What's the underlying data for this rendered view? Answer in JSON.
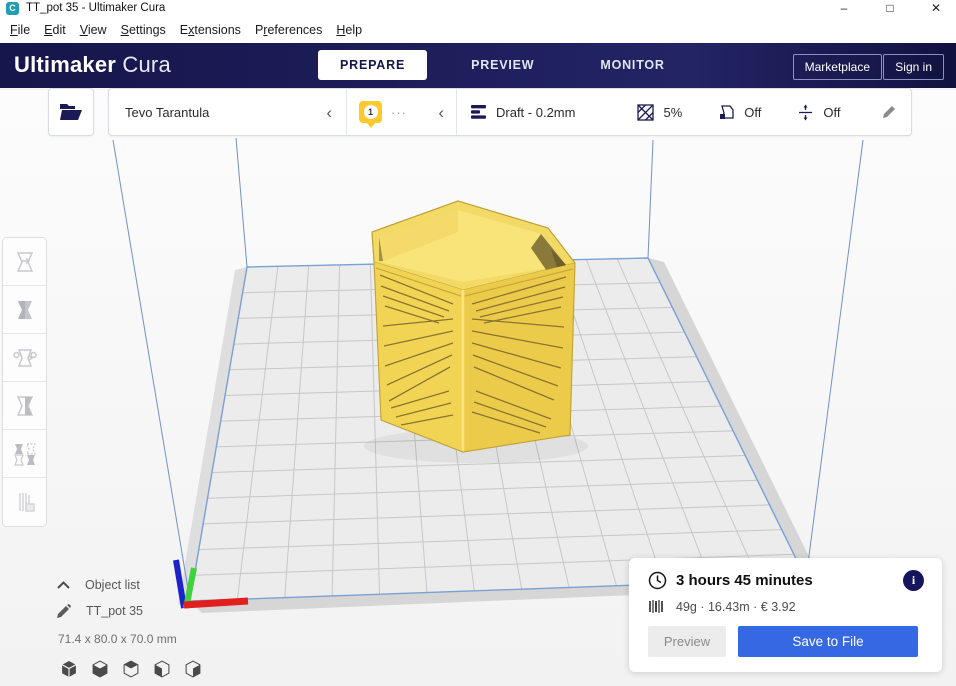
{
  "window": {
    "title": "TT_pot 35 - Ultimaker Cura",
    "controls": {
      "minimize": "–",
      "maximize": "□",
      "close": "✕"
    }
  },
  "menu": {
    "items": [
      {
        "name": "file",
        "pre": "",
        "key": "F",
        "post": "ile"
      },
      {
        "name": "edit",
        "pre": "",
        "key": "E",
        "post": "dit"
      },
      {
        "name": "view",
        "pre": "",
        "key": "V",
        "post": "iew"
      },
      {
        "name": "settings",
        "pre": "",
        "key": "S",
        "post": "ettings"
      },
      {
        "name": "extensions",
        "pre": "E",
        "key": "x",
        "post": "tensions"
      },
      {
        "name": "preferences",
        "pre": "P",
        "key": "r",
        "post": "eferences"
      },
      {
        "name": "help",
        "pre": "",
        "key": "H",
        "post": "elp"
      }
    ]
  },
  "header": {
    "brand_bold": "Ultimaker",
    "brand_light": "Cura",
    "tabs": [
      {
        "label": "PREPARE",
        "active": true
      },
      {
        "label": "PREVIEW",
        "active": false
      },
      {
        "label": "MONITOR",
        "active": false
      }
    ],
    "marketplace_label": "Marketplace",
    "signin_label": "Sign in"
  },
  "toolbar": {
    "printer_name": "Tevo Tarantula",
    "printer_chevron": "‹",
    "extruder_number": "1",
    "material_ellipsis": "···",
    "material_chevron": "‹",
    "profile": "Draft - 0.2mm",
    "infill": "5%",
    "support": "Off",
    "adhesion": "Off"
  },
  "scene": {
    "object_list_label": "Object list",
    "object_name": "TT_pot 35",
    "dimensions": "71.4 x 80.0 x 70.0 mm"
  },
  "summary": {
    "print_time": "3 hours 45 minutes",
    "material_usage": "49g · 16.43m · € 3.92",
    "info_glyph": "i",
    "preview_label": "Preview",
    "save_label": "Save to File"
  },
  "colors": {
    "header_navy": "#1a1b55",
    "accent_blue": "#3768e3",
    "material_yellow": "#fdc92f",
    "model_yellow": "#f2d455",
    "build_volume_blue": "#7aa0d4",
    "axis_x_red": "#e1201d",
    "axis_y_green": "#3fd23f",
    "axis_z_blue": "#1c24c8"
  }
}
